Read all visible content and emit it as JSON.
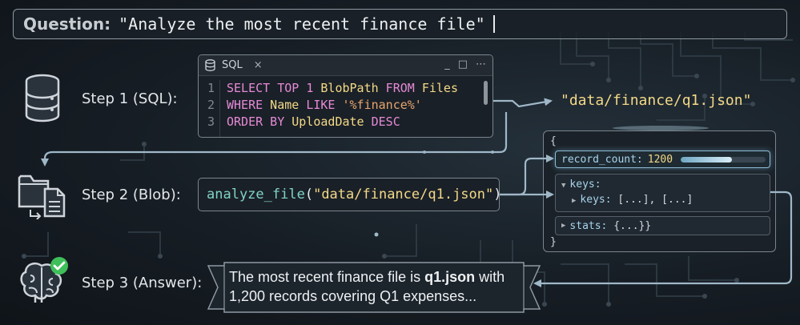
{
  "question": {
    "label": "Question:",
    "text": "\"Analyze the most recent finance file\""
  },
  "steps": [
    {
      "label": "Step 1 (SQL):",
      "icon": "database-icon"
    },
    {
      "label": "Step 2 (Blob):",
      "icon": "folder-file-icon"
    },
    {
      "label": "Step 3 (Answer):",
      "icon": "brain-check-icon"
    }
  ],
  "sql_editor": {
    "tab_title": "SQL",
    "close_glyph": "×",
    "controls": [
      "_",
      "□",
      "⋯"
    ],
    "line_numbers": [
      "1",
      "2",
      "3"
    ],
    "lines": [
      {
        "kw1": "SELECT TOP",
        "num": " 1 ",
        "id1": "BlobPath",
        "kw2": " FROM ",
        "id2": "Files"
      },
      {
        "kw1": "WHERE",
        "id1": " Name ",
        "kw2": "LIKE",
        "str": " '%finance%'"
      },
      {
        "kw1": "ORDER BY",
        "id1": " UploadDate ",
        "kw2": "DESC"
      }
    ]
  },
  "sql_result": "\"data/finance/q1.json\"",
  "blob_call": {
    "function": "analyze_file",
    "open_paren": "(",
    "argument": "\"data/finance/q1.json\"",
    "close_paren": ")"
  },
  "json_panel": {
    "open_brace": "{",
    "close_brace": "}",
    "record_count_key": "record_count:",
    "record_count_value": "1200",
    "record_count_fill": 0.6,
    "keys_label": "keys:",
    "keys_inner_label": "keys:",
    "keys_inner_value": "[...], [...]",
    "stats_label": "stats:",
    "stats_value": "{...}}"
  },
  "answer": {
    "prefix": "The most recent finance file is ",
    "filename": "q1.json",
    "suffix": " with 1,200 records covering Q1 expenses..."
  },
  "colors": {
    "keyword": "#e58ad6",
    "identifier": "#f3d987",
    "string": "#e7a46e",
    "function": "#7fd3c7",
    "json_key": "#a7d5ec",
    "connector": "#9fb8c8"
  }
}
